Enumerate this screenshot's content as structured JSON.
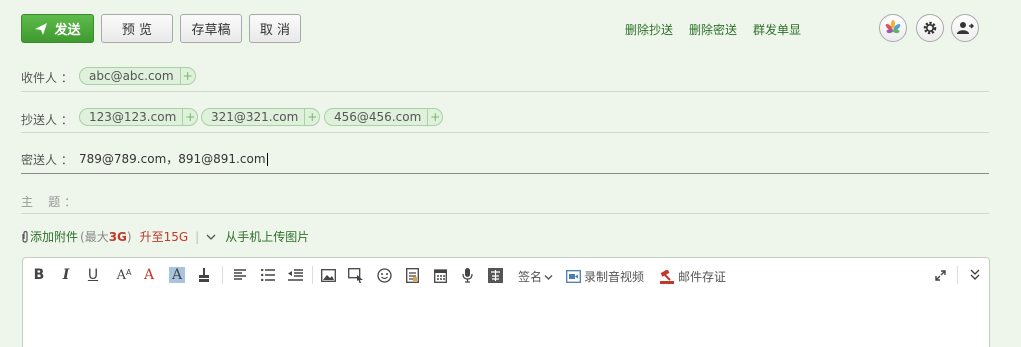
{
  "toolbar": {
    "send_label": "发送",
    "preview_label": "预 览",
    "draft_label": "存草稿",
    "cancel_label": "取 消",
    "links": [
      "删除抄送",
      "删除密送",
      "群发单显"
    ]
  },
  "fields": {
    "to_label": "收件人 ：",
    "to_chips": [
      "abc@abc.com"
    ],
    "cc_label": "抄送人 ：",
    "cc_chips": [
      "123@123.com",
      "321@321.com",
      "456@456.com"
    ],
    "bcc_label": "密送人 ：",
    "bcc_value": "789@789.com，891@891.com",
    "subject_label": "主    题 ："
  },
  "attachment": {
    "add_label": "添加附件",
    "limit_open": "(最大",
    "limit_value": "3G",
    "limit_close": ")",
    "upgrade_label": "升至15G",
    "sep": "|",
    "mobile_label": "从手机上传图片"
  },
  "editor": {
    "bold": "B",
    "italic": "I",
    "underline": "U",
    "fontsize": "A",
    "fontsize_small": "A",
    "color": "A",
    "bg": "A",
    "signature_label": "签名",
    "video_label": "录制音视频",
    "evidence_label": "邮件存证"
  },
  "colors": {
    "send_green": "#4caf3d",
    "link_green": "#2f6f2a",
    "background": "#eef6ec",
    "accent_red": "#c0392b"
  }
}
